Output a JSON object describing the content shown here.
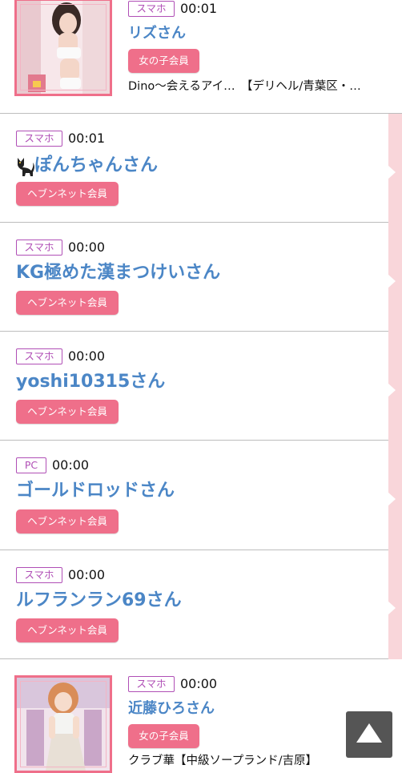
{
  "entries": [
    {
      "device": "スマホ",
      "time": "00:01",
      "name": "リズさん",
      "member": "女の子会員",
      "shop": "Dino～会えるアイ…　【デリヘル/青葉区・…"
    },
    {
      "device": "スマホ",
      "time": "00:01",
      "name": "ぽんちゃんさん",
      "member": "ヘブンネット会員"
    },
    {
      "device": "スマホ",
      "time": "00:00",
      "name": "KG極めた漢まつけいさん",
      "member": "ヘブンネット会員"
    },
    {
      "device": "スマホ",
      "time": "00:00",
      "name": "yoshi10315さん",
      "member": "ヘブンネット会員"
    },
    {
      "device": "PC",
      "time": "00:00",
      "name": "ゴールドロッドさん",
      "member": "ヘブンネット会員"
    },
    {
      "device": "スマホ",
      "time": "00:00",
      "name": "ルフランラン69さん",
      "member": "ヘブンネット会員"
    },
    {
      "device": "スマホ",
      "time": "00:00",
      "name": "近藤ひろさん",
      "member": "女の子会員",
      "shop": "クラブ華【中級ソープランド/吉原】"
    }
  ],
  "icons": {
    "cat": "cat-icon",
    "scroll_top": "up-triangle-icon"
  },
  "colors": {
    "name_blue": "#4b86c6",
    "badge_pink": "#ef6f8a",
    "device_purple": "#b04fb6",
    "strip_pink": "#f9d6da"
  }
}
